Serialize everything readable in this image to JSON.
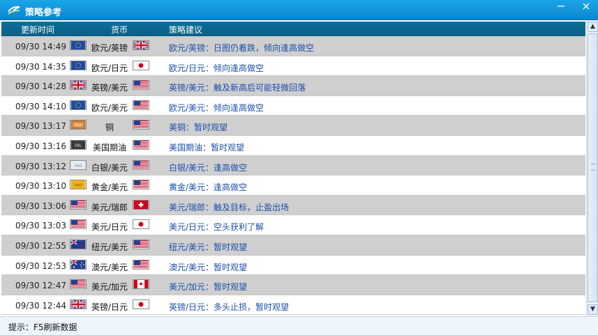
{
  "window": {
    "title": "策略参考",
    "minimize_label": "−",
    "close_label": "×"
  },
  "table": {
    "headers": {
      "time": "更新时间",
      "currency": "货币",
      "suggestion": "策略建议"
    },
    "rows": [
      {
        "time": "09/30 14:49",
        "pair": "欧元/英镑",
        "flag1": "eu-flag",
        "flag2": "uk-flag",
        "suggestion": "欧元/英镑：日图仍看跌，倾向逢高做空"
      },
      {
        "time": "09/30 14:35",
        "pair": "欧元/日元",
        "flag1": "eu-flag",
        "flag2": "jp-flag",
        "suggestion": "欧元/日元：倾向逢高做空"
      },
      {
        "time": "09/30 14:28",
        "pair": "英镑/美元",
        "flag1": "uk-flag",
        "flag2": "us-flag",
        "suggestion": "英镑/美元：触及新高后可能轻微回落"
      },
      {
        "time": "09/30 14:10",
        "pair": "欧元/美元",
        "flag1": "eu-flag",
        "flag2": "us-flag",
        "suggestion": "欧元/美元：倾向逢高做空"
      },
      {
        "time": "09/30 13:17",
        "pair": "铜",
        "flag1": "cu-icon",
        "flag2": "us-flag",
        "flag1_text": "CU",
        "suggestion": "美铜：暂时观望"
      },
      {
        "time": "09/30 13:16",
        "pair": "美国期油",
        "flag1": "oil-icon",
        "flag2": "us-flag",
        "flag1_text": "OIL",
        "suggestion": "美国期油：暂时观望"
      },
      {
        "time": "09/30 13:12",
        "pair": "白银/美元",
        "flag1": "xag-icon",
        "flag2": "us-flag",
        "flag1_text": "XAG",
        "suggestion": "白银/美元：逢高做空"
      },
      {
        "time": "09/30 13:10",
        "pair": "黄金/美元",
        "flag1": "xau-icon",
        "flag2": "us-flag",
        "flag1_text": "XAU",
        "suggestion": "黄金/美元：逢高做空"
      },
      {
        "time": "09/30 13:06",
        "pair": "美元/瑞郎",
        "flag1": "us-flag",
        "flag2": "ch-flag",
        "suggestion": "美元/瑞郎：触及目标，止盈出场"
      },
      {
        "time": "09/30 13:03",
        "pair": "美元/日元",
        "flag1": "us-flag",
        "flag2": "jp-flag",
        "suggestion": "美元/日元：空头获利了解"
      },
      {
        "time": "09/30 12:55",
        "pair": "纽元/美元",
        "flag1": "nz-flag",
        "flag2": "us-flag",
        "suggestion": "纽元/美元：暂时观望"
      },
      {
        "time": "09/30 12:53",
        "pair": "澳元/美元",
        "flag1": "au-flag",
        "flag2": "us-flag",
        "suggestion": "澳元/美元：暂时观望"
      },
      {
        "time": "09/30 12:47",
        "pair": "美元/加元",
        "flag1": "us-flag",
        "flag2": "ca-flag",
        "suggestion": "美元/加元：暂时观望"
      },
      {
        "time": "09/30 12:44",
        "pair": "英镑/日元",
        "flag1": "uk-flag",
        "flag2": "jp-flag",
        "suggestion": "英镑/日元：多头止损，暂时观望"
      }
    ]
  },
  "status": {
    "hint": "提示：F5刷新数据"
  },
  "colors": {
    "titlebar": "#0b84cf",
    "header": "#0d6f98",
    "link": "#1a4fa8",
    "alt_row": "#cfcfcf"
  },
  "scroll_icons": {
    "up": "▲",
    "down": "▼"
  }
}
